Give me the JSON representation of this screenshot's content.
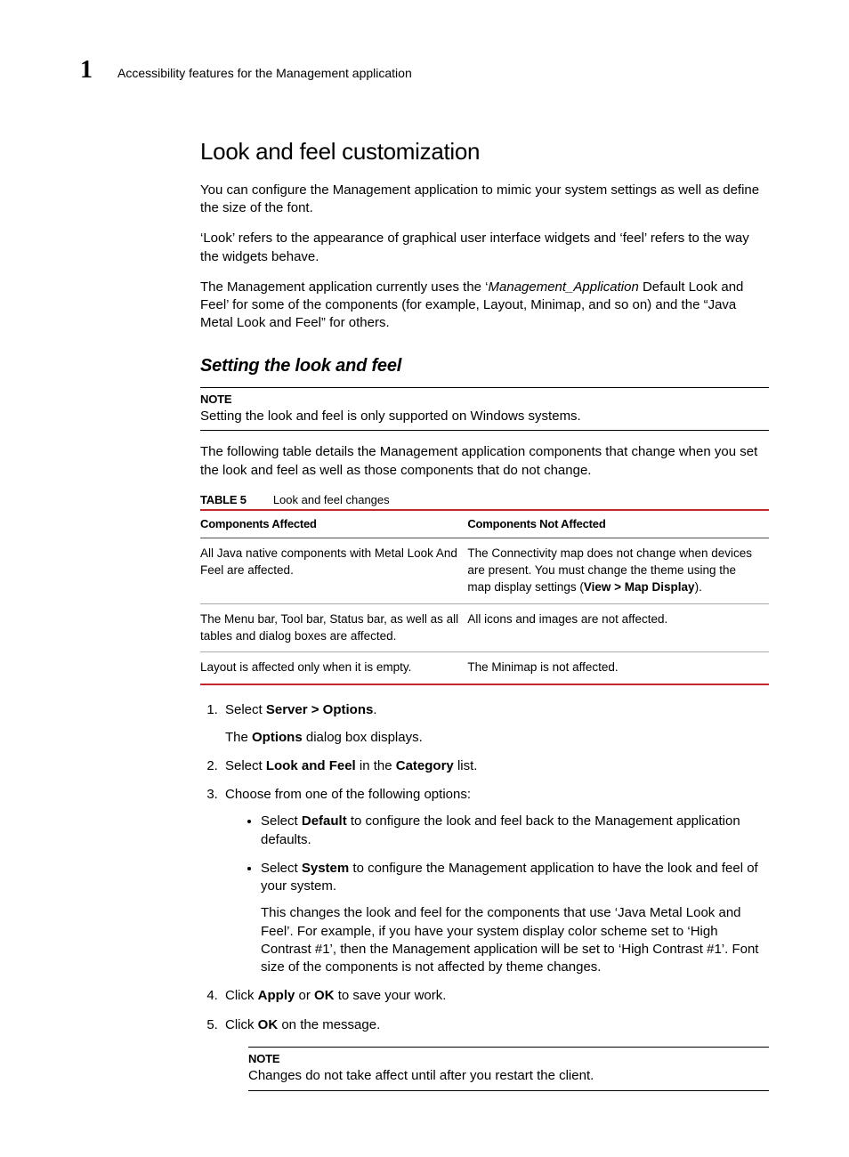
{
  "chapterNumber": "1",
  "runningTitle": "Accessibility features for the Management application",
  "sectionTitle": "Look and feel customization",
  "para1": "You can configure the Management application to mimic your system settings as well as define the size of the font.",
  "para2": "‘Look’ refers to the appearance of graphical user interface widgets and ‘feel’ refers to the way the widgets behave.",
  "para3_pre": "The Management application currently uses the ‘",
  "para3_em": "Management_Application",
  "para3_post": " Default Look and Feel’ for some of the components (for example, Layout, Minimap, and so on) and the “Java Metal Look and Feel” for others.",
  "subhead": "Setting the look and feel",
  "note1": {
    "label": "NOTE",
    "text": "Setting the look and feel is only supported on Windows systems."
  },
  "para4": "The following table details the Management application components that change when you set the look and feel as well as those components that do not change.",
  "tableCaption": {
    "num": "TABLE 5",
    "title": "Look and feel changes"
  },
  "table": {
    "headers": [
      "Components Affected",
      "Components Not Affected"
    ],
    "rows": [
      {
        "c0": "All Java native components with Metal Look And Feel are affected.",
        "c1_pre": "The Connectivity map does not change when devices are present. You must change the theme using the map display settings (",
        "c1_bold": "View > Map Display",
        "c1_post": ")."
      },
      {
        "c0": "The Menu bar, Tool bar, Status bar, as well as all tables and dialog boxes are affected.",
        "c1_pre": "All icons and images are not affected.",
        "c1_bold": "",
        "c1_post": ""
      },
      {
        "c0": "Layout is affected only when it is empty.",
        "c1_pre": "The Minimap is not affected.",
        "c1_bold": "",
        "c1_post": ""
      }
    ]
  },
  "steps": {
    "s1_pre": "Select ",
    "s1_bold": "Server > Options",
    "s1_post": ".",
    "s1_sub_pre": "The ",
    "s1_sub_bold": "Options",
    "s1_sub_post": " dialog box displays.",
    "s2_pre": "Select ",
    "s2_bold1": "Look and Feel",
    "s2_mid": " in the ",
    "s2_bold2": "Category",
    "s2_post": " list.",
    "s3": "Choose from one of the following options:",
    "s3_b1_pre": "Select ",
    "s3_b1_bold": "Default",
    "s3_b1_post": " to configure the look and feel back to the Management application defaults.",
    "s3_b2_pre": "Select ",
    "s3_b2_bold": "System",
    "s3_b2_post": " to configure the Management application to have the look and feel of your system.",
    "s3_b2_p2": "This changes the look and feel for the components that use ‘Java Metal Look and Feel’. For example, if you have your system display color scheme set to ‘High Contrast #1’, then the Management application will be set to ‘High Contrast #1’. Font size of the components is not affected by theme changes.",
    "s4_pre": "Click ",
    "s4_bold1": "Apply",
    "s4_mid": " or ",
    "s4_bold2": "OK",
    "s4_post": " to save your work.",
    "s5_pre": "Click ",
    "s5_bold": "OK",
    "s5_post": " on the message."
  },
  "note2": {
    "label": "NOTE",
    "text": "Changes do not take affect until after you restart the client."
  }
}
